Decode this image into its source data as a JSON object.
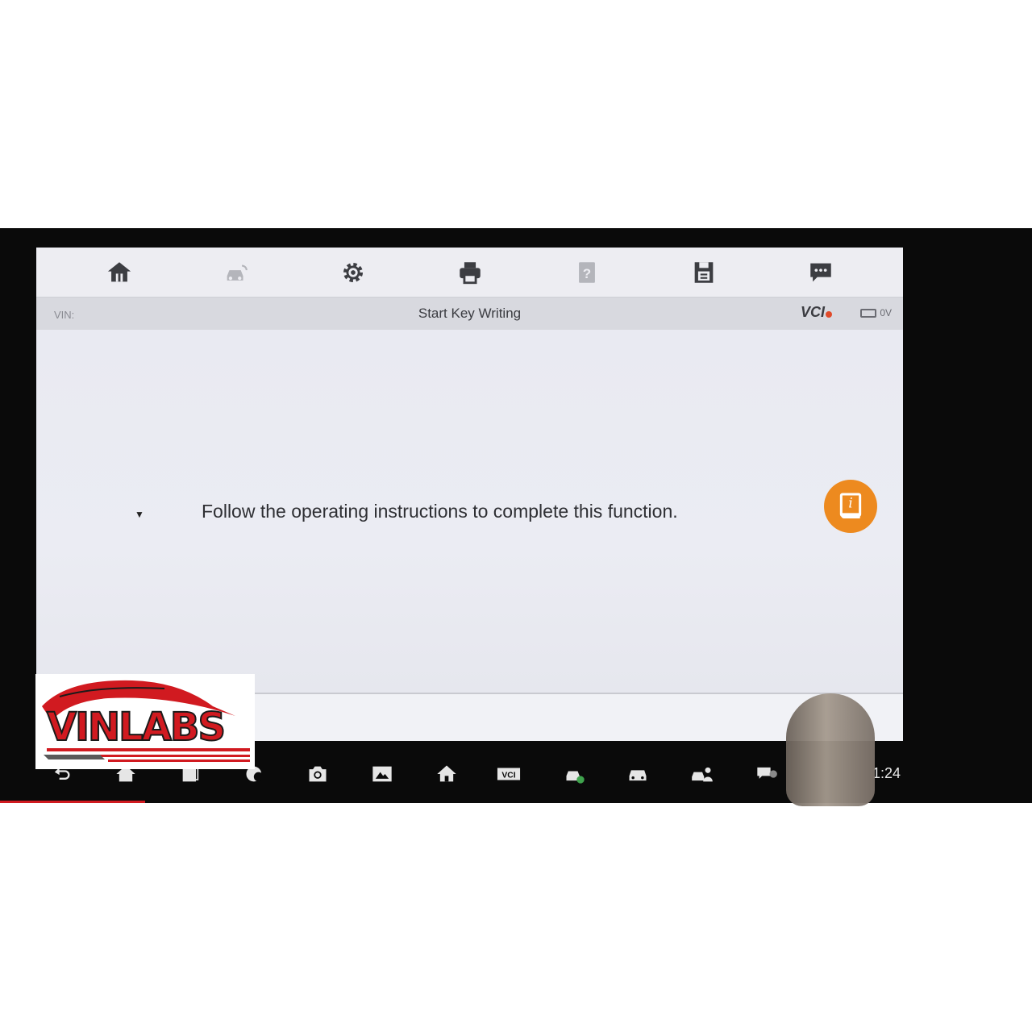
{
  "toolbar": {
    "buttons": [
      {
        "name": "home-icon"
      },
      {
        "name": "vehicle-swap-icon"
      },
      {
        "name": "settings-gear-icon"
      },
      {
        "name": "print-icon"
      },
      {
        "name": "help-document-icon"
      },
      {
        "name": "save-icon"
      },
      {
        "name": "message-icon"
      }
    ]
  },
  "infobar": {
    "vin_label": "VIN:",
    "title": "Start Key Writing",
    "vci_label": "VCI",
    "voltage": "0V"
  },
  "content": {
    "message": "Follow the operating instructions to complete this function.",
    "help_button_icon": "info-book-icon",
    "help_button_color": "#ed8a1f"
  },
  "android_navbar": {
    "icons": [
      "back-icon",
      "home-icon",
      "recent-apps-icon",
      "browser-icon",
      "camera-icon",
      "display-icon",
      "home-icon",
      "vci-icon",
      "vehicle-check-icon",
      "car-icon",
      "car-service-icon",
      "chat-icon"
    ],
    "time": "1:24"
  },
  "watermark": {
    "text": "VINLABS",
    "brand_color": "#d11a20"
  }
}
